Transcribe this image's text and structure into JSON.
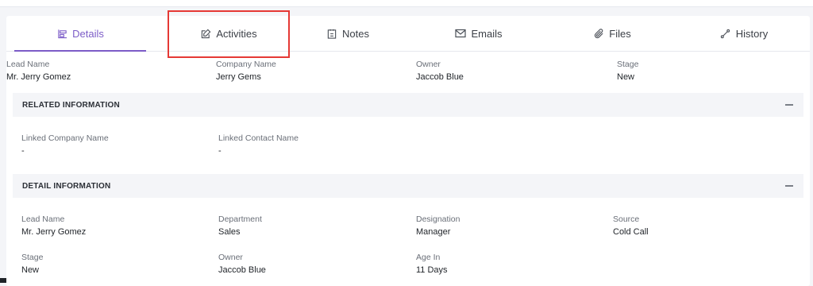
{
  "tabs": [
    {
      "label": "Details",
      "icon": "details-icon",
      "active": true
    },
    {
      "label": "Activities",
      "icon": "edit-icon",
      "active": false
    },
    {
      "label": "Notes",
      "icon": "notes-icon",
      "active": false
    },
    {
      "label": "Emails",
      "icon": "mail-icon",
      "active": false
    },
    {
      "label": "Files",
      "icon": "paperclip-icon",
      "active": false
    },
    {
      "label": "History",
      "icon": "history-icon",
      "active": false
    }
  ],
  "summary": {
    "lead_name": {
      "label": "Lead Name",
      "value": "Mr. Jerry Gomez"
    },
    "company_name": {
      "label": "Company Name",
      "value": "Jerry Gems"
    },
    "owner": {
      "label": "Owner",
      "value": "Jaccob Blue"
    },
    "stage": {
      "label": "Stage",
      "value": "New"
    }
  },
  "related": {
    "title": "RELATED INFORMATION",
    "linked_company": {
      "label": "Linked Company Name",
      "value": "-"
    },
    "linked_contact": {
      "label": "Linked Contact Name",
      "value": "-"
    }
  },
  "detail": {
    "title": "DETAIL INFORMATION",
    "lead_name": {
      "label": "Lead Name",
      "value": "Mr. Jerry Gomez"
    },
    "department": {
      "label": "Department",
      "value": "Sales"
    },
    "designation": {
      "label": "Designation",
      "value": "Manager"
    },
    "source": {
      "label": "Source",
      "value": "Cold Call"
    },
    "stage": {
      "label": "Stage",
      "value": "New"
    },
    "owner": {
      "label": "Owner",
      "value": "Jaccob Blue"
    },
    "age_in": {
      "label": "Age In",
      "value": "11 Days"
    }
  },
  "colors": {
    "accent": "#7c5cc7",
    "highlight": "#e53935",
    "section_bg": "#f4f5f8"
  }
}
